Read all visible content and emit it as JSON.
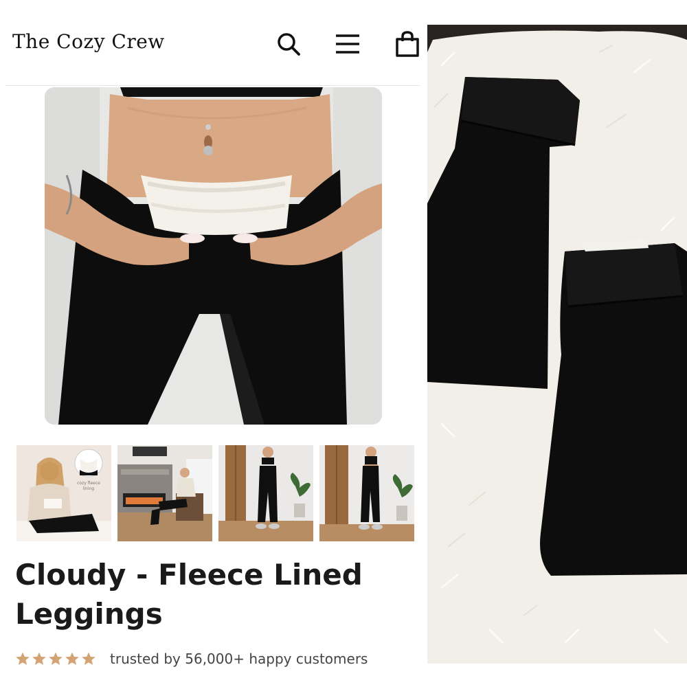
{
  "header": {
    "store_name": "The Cozy Crew",
    "icons": [
      "search-icon",
      "menu-icon",
      "cart-icon"
    ]
  },
  "product": {
    "title": "Cloudy - Fleece Lined Leggings",
    "rating_stars": 5,
    "trust_text": "trusted by 56,000+ happy customers"
  },
  "gallery": {
    "thumbnail_count": 4,
    "thumb1_badge": "cozy fleece lining"
  },
  "colors": {
    "star": "#d4a373",
    "text_dark": "#1a1a1a",
    "legging": "#0d0d0d",
    "fleece": "#f4f1ea"
  }
}
